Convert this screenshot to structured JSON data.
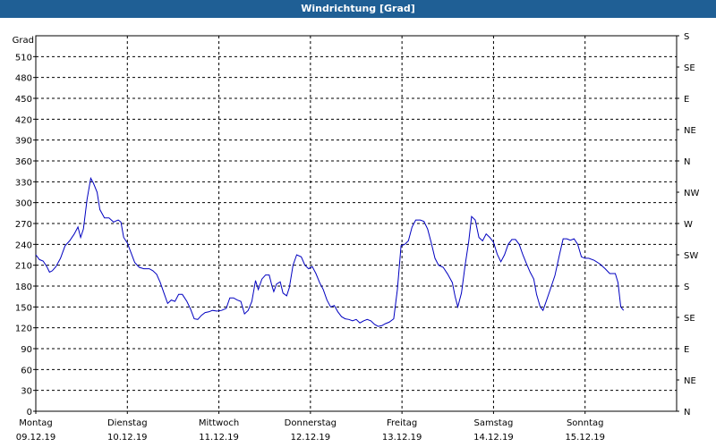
{
  "window": {
    "title": "Windrichtung [Grad]"
  },
  "chart_data": {
    "type": "line",
    "title": "Windrichtung [Grad]",
    "ylabel": "Grad",
    "ylim": [
      0,
      540
    ],
    "yticks": [
      0,
      30,
      60,
      90,
      120,
      150,
      180,
      210,
      240,
      270,
      300,
      330,
      360,
      390,
      420,
      450,
      480,
      510
    ],
    "right_axis_labels": [
      {
        "value": 0,
        "label": "N"
      },
      {
        "value": 45,
        "label": "NE"
      },
      {
        "value": 90,
        "label": "E"
      },
      {
        "value": 135,
        "label": "SE"
      },
      {
        "value": 180,
        "label": "S"
      },
      {
        "value": 225,
        "label": "SW"
      },
      {
        "value": 270,
        "label": "W"
      },
      {
        "value": 315,
        "label": "NW"
      },
      {
        "value": 360,
        "label": "N"
      },
      {
        "value": 405,
        "label": "NE"
      },
      {
        "value": 450,
        "label": "E"
      },
      {
        "value": 495,
        "label": "SE"
      },
      {
        "value": 540,
        "label": "S"
      }
    ],
    "xlim": [
      0,
      7
    ],
    "x_unit": "days from Montag 09.12.19",
    "x_ticks": [
      {
        "day": "Montag",
        "date": "09.12.19",
        "x": 0
      },
      {
        "day": "Dienstag",
        "date": "10.12.19",
        "x": 1
      },
      {
        "day": "Mittwoch",
        "date": "11.12.19",
        "x": 2
      },
      {
        "day": "Donnerstag",
        "date": "12.12.19",
        "x": 3
      },
      {
        "day": "Freitag",
        "date": "13.12.19",
        "x": 4
      },
      {
        "day": "Samstag",
        "date": "14.12.19",
        "x": 5
      },
      {
        "day": "Sonntag",
        "date": "15.12.19",
        "x": 6
      }
    ],
    "grid": true,
    "line_color": "#0000c0",
    "series": [
      {
        "points": [
          [
            0.0,
            225
          ],
          [
            0.04,
            218
          ],
          [
            0.08,
            216
          ],
          [
            0.12,
            208
          ],
          [
            0.15,
            200
          ],
          [
            0.18,
            202
          ],
          [
            0.22,
            208
          ],
          [
            0.27,
            220
          ],
          [
            0.32,
            238
          ],
          [
            0.37,
            245
          ],
          [
            0.42,
            255
          ],
          [
            0.46,
            265
          ],
          [
            0.49,
            250
          ],
          [
            0.52,
            262
          ],
          [
            0.56,
            305
          ],
          [
            0.6,
            335
          ],
          [
            0.63,
            328
          ],
          [
            0.67,
            315
          ],
          [
            0.7,
            290
          ],
          [
            0.75,
            278
          ],
          [
            0.8,
            278
          ],
          [
            0.85,
            272
          ],
          [
            0.9,
            275
          ],
          [
            0.93,
            272
          ],
          [
            0.96,
            250
          ],
          [
            1.0,
            242
          ],
          [
            1.04,
            228
          ],
          [
            1.08,
            214
          ],
          [
            1.13,
            207
          ],
          [
            1.18,
            205
          ],
          [
            1.24,
            205
          ],
          [
            1.28,
            202
          ],
          [
            1.32,
            197
          ],
          [
            1.36,
            185
          ],
          [
            1.4,
            170
          ],
          [
            1.44,
            155
          ],
          [
            1.48,
            160
          ],
          [
            1.52,
            158
          ],
          [
            1.56,
            168
          ],
          [
            1.6,
            168
          ],
          [
            1.65,
            158
          ],
          [
            1.69,
            147
          ],
          [
            1.73,
            133
          ],
          [
            1.77,
            132
          ],
          [
            1.81,
            138
          ],
          [
            1.85,
            142
          ],
          [
            1.89,
            143
          ],
          [
            1.93,
            145
          ],
          [
            1.98,
            144
          ],
          [
            2.03,
            145
          ],
          [
            2.08,
            148
          ],
          [
            2.12,
            163
          ],
          [
            2.16,
            163
          ],
          [
            2.2,
            160
          ],
          [
            2.24,
            158
          ],
          [
            2.28,
            140
          ],
          [
            2.32,
            145
          ],
          [
            2.36,
            158
          ],
          [
            2.4,
            188
          ],
          [
            2.43,
            175
          ],
          [
            2.47,
            190
          ],
          [
            2.51,
            196
          ],
          [
            2.55,
            196
          ],
          [
            2.58,
            180
          ],
          [
            2.6,
            172
          ],
          [
            2.63,
            183
          ],
          [
            2.67,
            186
          ],
          [
            2.7,
            170
          ],
          [
            2.74,
            166
          ],
          [
            2.77,
            178
          ],
          [
            2.81,
            210
          ],
          [
            2.85,
            225
          ],
          [
            2.9,
            222
          ],
          [
            2.94,
            210
          ],
          [
            2.98,
            205
          ],
          [
            3.02,
            208
          ],
          [
            3.06,
            198
          ],
          [
            3.1,
            185
          ],
          [
            3.14,
            175
          ],
          [
            3.18,
            160
          ],
          [
            3.22,
            150
          ],
          [
            3.26,
            152
          ],
          [
            3.3,
            143
          ],
          [
            3.34,
            136
          ],
          [
            3.38,
            133
          ],
          [
            3.42,
            132
          ],
          [
            3.46,
            130
          ],
          [
            3.5,
            132
          ],
          [
            3.54,
            127
          ],
          [
            3.58,
            130
          ],
          [
            3.62,
            132
          ],
          [
            3.66,
            130
          ],
          [
            3.7,
            125
          ],
          [
            3.74,
            122
          ],
          [
            3.78,
            123
          ],
          [
            3.82,
            126
          ],
          [
            3.86,
            128
          ],
          [
            3.91,
            133
          ],
          [
            3.95,
            175
          ],
          [
            3.99,
            238
          ],
          [
            4.03,
            240
          ],
          [
            4.07,
            245
          ],
          [
            4.11,
            265
          ],
          [
            4.15,
            275
          ],
          [
            4.2,
            275
          ],
          [
            4.24,
            273
          ],
          [
            4.28,
            262
          ],
          [
            4.32,
            242
          ],
          [
            4.36,
            220
          ],
          [
            4.4,
            210
          ],
          [
            4.45,
            207
          ],
          [
            4.5,
            197
          ],
          [
            4.55,
            185
          ],
          [
            4.58,
            165
          ],
          [
            4.61,
            150
          ],
          [
            4.65,
            170
          ],
          [
            4.69,
            210
          ],
          [
            4.73,
            245
          ],
          [
            4.76,
            280
          ],
          [
            4.8,
            275
          ],
          [
            4.84,
            250
          ],
          [
            4.88,
            245
          ],
          [
            4.92,
            255
          ],
          [
            4.96,
            250
          ],
          [
            5.0,
            243
          ],
          [
            5.04,
            226
          ],
          [
            5.08,
            215
          ],
          [
            5.12,
            225
          ],
          [
            5.16,
            240
          ],
          [
            5.2,
            247
          ],
          [
            5.24,
            247
          ],
          [
            5.28,
            240
          ],
          [
            5.32,
            225
          ],
          [
            5.36,
            212
          ],
          [
            5.4,
            200
          ],
          [
            5.44,
            190
          ],
          [
            5.47,
            168
          ],
          [
            5.51,
            150
          ],
          [
            5.54,
            145
          ],
          [
            5.58,
            160
          ],
          [
            5.62,
            175
          ],
          [
            5.67,
            195
          ],
          [
            5.72,
            225
          ],
          [
            5.76,
            248
          ],
          [
            5.8,
            248
          ],
          [
            5.84,
            246
          ],
          [
            5.88,
            248
          ],
          [
            5.92,
            240
          ],
          [
            5.96,
            222
          ],
          [
            6.0,
            220
          ],
          [
            6.04,
            220
          ],
          [
            6.1,
            217
          ],
          [
            6.16,
            212
          ],
          [
            6.22,
            205
          ],
          [
            6.27,
            198
          ],
          [
            6.33,
            198
          ],
          [
            6.36,
            185
          ],
          [
            6.39,
            150
          ],
          [
            6.42,
            145
          ]
        ]
      }
    ]
  }
}
